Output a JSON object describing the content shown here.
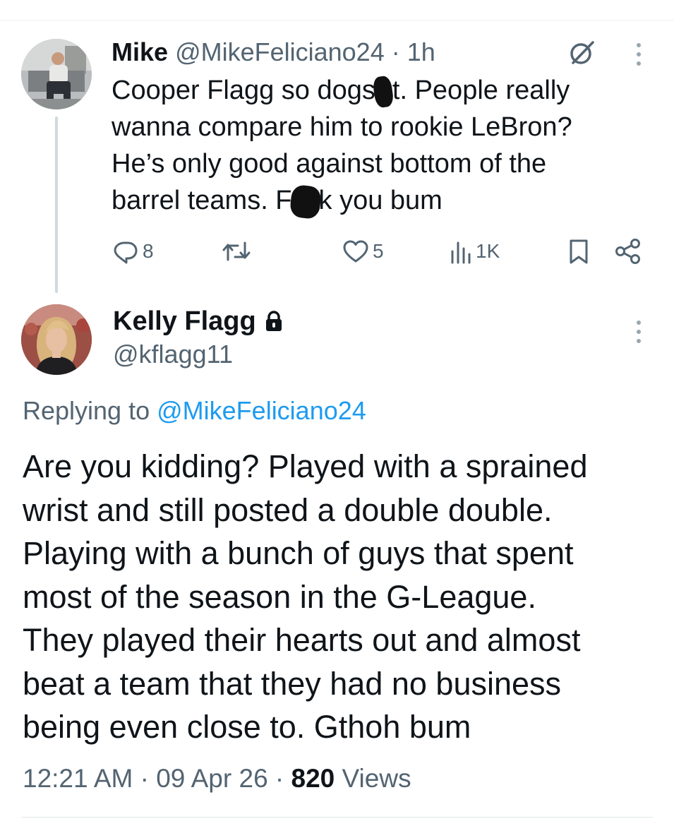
{
  "parent_tweet": {
    "author_name": "Mike",
    "handle": "@MikeFeliciano24",
    "separator": "·",
    "time_ago": "1h",
    "text_lines": [
      [
        "Cooper Flagg so dogs",
        "t. People really"
      ],
      "wanna compare him to rookie LeBron?",
      "He’s only good against bottom of the",
      [
        "barrel teams. F",
        "k you bum"
      ]
    ],
    "stats": {
      "replies": "8",
      "retweets": "",
      "likes": "5",
      "views": "1K"
    }
  },
  "reply_tweet": {
    "author_name": "Kelly Flagg",
    "protected_icon": "lock-icon",
    "handle": "@kflagg11",
    "replying_prefix": "Replying to",
    "replying_mention": "@MikeFeliciano24",
    "text_lines": [
      "Are you kidding? Played with a sprained",
      "wrist and still posted a double double.",
      "Playing with a bunch of guys that spent",
      "most of the season in the G-League.",
      "They played their hearts out and almost",
      "beat a team that they had no business",
      "being even close to. Gthoh bum"
    ],
    "meta": {
      "time": "12:21 AM",
      "date": "09 Apr 26",
      "views_count": "820",
      "views_label": "Views",
      "separator": "·"
    }
  },
  "icons": {
    "reply": "reply-icon",
    "retweet": "retweet-icon",
    "like": "heart-icon",
    "views": "views-chart-icon",
    "bookmark": "bookmark-icon",
    "share": "share-icon",
    "grok": "grok-icon",
    "more": "more-vertical-icon"
  },
  "colors": {
    "text_primary": "#0f1419",
    "text_muted": "#536471",
    "link": "#1d9bf0",
    "thread_line": "#cfd9de"
  }
}
